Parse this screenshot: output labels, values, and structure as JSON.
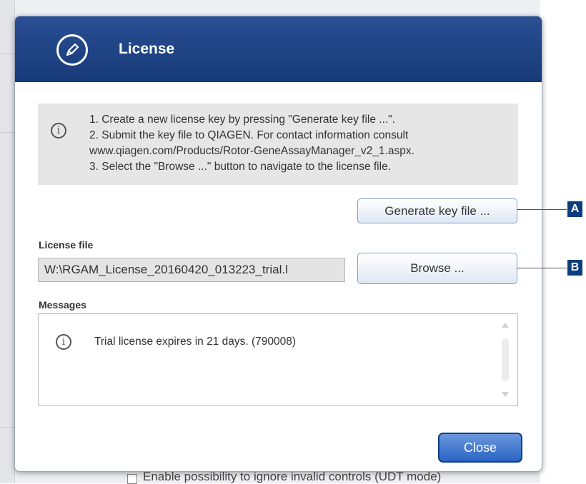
{
  "background": {
    "footer_text": "Enable possibility to ignore invalid controls (UDT mode)"
  },
  "dialog": {
    "title": "License",
    "icon": "pencil-icon",
    "info": {
      "icon": "info-icon",
      "lines": [
        "1. Create a new license key by pressing \"Generate key file ...\".",
        "2. Submit the key file to QIAGEN. For contact information consult",
        "www.qiagen.com/Products/Rotor-GeneAssayManager_v2_1.aspx.",
        "3. Select the \"Browse ...\" button to navigate to the license file."
      ]
    },
    "generate_button": "Generate key file ...",
    "license_file_label": "License file",
    "license_file_value": "W:\\RGAM_License_20160420_013223_trial.l",
    "browse_button": "Browse ...",
    "messages_label": "Messages",
    "messages": [
      {
        "icon": "info-icon",
        "text": "Trial license expires in 21 days. (790008)"
      }
    ],
    "close_button": "Close"
  },
  "callouts": {
    "a": "A",
    "b": "B"
  },
  "colors": {
    "header_top": "#2a4f93",
    "header_bottom": "#163a78",
    "close_button": "#2a64c4",
    "callout_badge": "#0c3d7e"
  }
}
